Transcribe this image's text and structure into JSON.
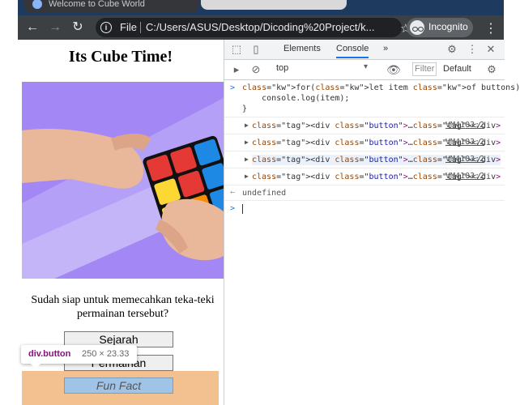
{
  "browser": {
    "tab_title": "Welcome to Cube World",
    "url_scheme": "File",
    "url": "C:/Users/ASUS/Desktop/Dicoding%20Project/k...",
    "profile_label": "Incognito",
    "nav": {
      "back": "←",
      "forward": "→",
      "reload": "↻",
      "star": "☆",
      "menu": "⋮"
    }
  },
  "page": {
    "title": "Its Cube Time!",
    "question": "Sudah siap untuk memecahkan teka-teki permainan tersebut?",
    "buttons": [
      {
        "label": "Sejarah"
      },
      {
        "label": "Permainan"
      },
      {
        "label": "Fun Fact"
      }
    ],
    "tooltip": {
      "tag": "div.button",
      "size": "250 × 23.33"
    }
  },
  "devtools": {
    "tabs": [
      "Elements",
      "Console"
    ],
    "active_tab": "Console",
    "more_tabs": "»",
    "context": "top",
    "filter_placeholder": "Filter",
    "levels": "Default",
    "input": {
      "line1": "for(let item of buttons){",
      "line2": "    console.log(item);",
      "line3": "}"
    },
    "outputs": [
      {
        "text": "<div class=\"button\">…</div>",
        "source": "VM4103:2"
      },
      {
        "text": "<div class=\"button\">…</div>",
        "source": "VM4103:2"
      },
      {
        "text": "<div class=\"button\">…</div>",
        "source": "VM4103:2"
      },
      {
        "text": "<div class=\"button\">…</div>",
        "source": "VM4103:2"
      }
    ],
    "return_value": "undefined"
  },
  "colors": {
    "tab_strip": "#1f3a5f",
    "toolbar": "#3c4043",
    "hero_bg": "#a388f5",
    "highlight": "#f3c18f",
    "selected_button": "#9fc4e8",
    "accent": "#1a73e8"
  }
}
